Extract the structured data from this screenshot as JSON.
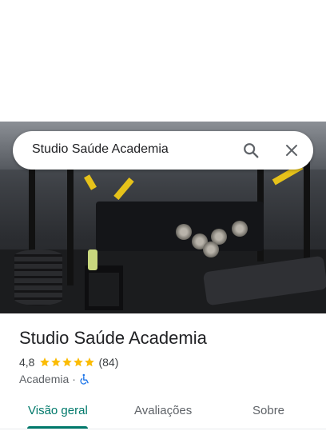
{
  "search": {
    "query": "Studio Saúde Academia",
    "search_icon": "search-icon",
    "close_icon": "close-icon"
  },
  "place": {
    "name": "Studio Saúde Academia",
    "rating": "4,8",
    "stars": 5,
    "review_count": "(84)",
    "category": "Academia",
    "separator": "·",
    "accessibility_icon": "wheelchair-icon"
  },
  "tabs": [
    {
      "label": "Visão geral",
      "selected": true
    },
    {
      "label": "Avaliações",
      "selected": false
    },
    {
      "label": "Sobre",
      "selected": false
    }
  ],
  "colors": {
    "accent": "#00796b",
    "star": "#fbbc04",
    "accessibility": "#1a73e8"
  }
}
